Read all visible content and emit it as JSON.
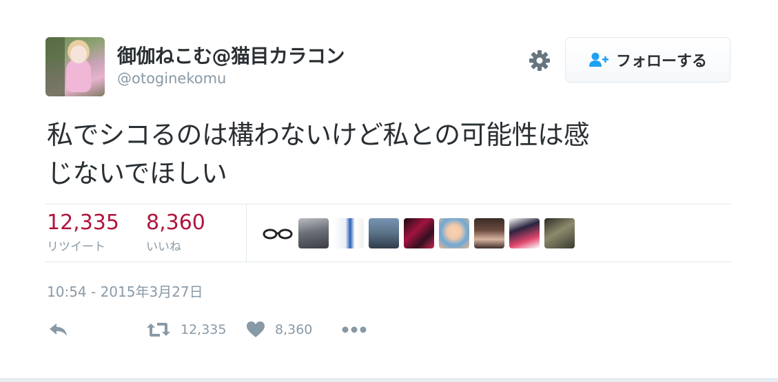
{
  "tweet": {
    "author": {
      "display_name": "御伽ねこむ@猫目カラコン",
      "screen_name": "@otoginekomu",
      "avatar_icon": "user-avatar"
    },
    "settings_icon": "gear-icon",
    "follow_button": {
      "label": "フォローする",
      "icon": "person-add-icon"
    },
    "text_line1": "私でシコるのは構わないけど私との可能性は感",
    "text_line2": "じないでほしい",
    "stats": {
      "retweets": {
        "count": "12,335",
        "label": "リツイート"
      },
      "likes": {
        "count": "8,360",
        "label": "いいね"
      }
    },
    "likers": [
      "glasses-avatar",
      "liker-avatar-2",
      "liker-avatar-3",
      "liker-avatar-4",
      "liker-avatar-5",
      "liker-avatar-6",
      "liker-avatar-7",
      "liker-avatar-8",
      "liker-avatar-9"
    ],
    "timestamp": "10:54 - 2015年3月27日",
    "actions": {
      "reply_icon": "reply-icon",
      "retweet_icon": "retweet-icon",
      "retweet_count": "12,335",
      "like_icon": "heart-icon",
      "like_count": "8,360",
      "more_icon": "more-icon"
    }
  },
  "colors": {
    "count_accent": "#b0143c",
    "muted_text": "#8899a6",
    "primary_text": "#292f33",
    "divider": "#e1e8ed",
    "follow_icon": "#1da1f2"
  }
}
